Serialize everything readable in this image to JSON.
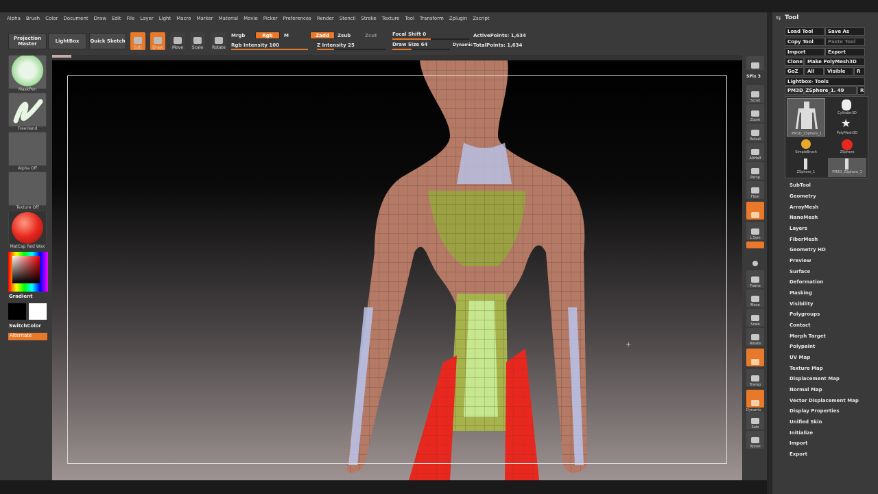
{
  "menu": [
    "Alpha",
    "Brush",
    "Color",
    "Document",
    "Draw",
    "Edit",
    "File",
    "Layer",
    "Light",
    "Macro",
    "Marker",
    "Material",
    "Movie",
    "Picker",
    "Preferences",
    "Render",
    "Stencil",
    "Stroke",
    "Texture",
    "Tool",
    "Transform",
    "Zplugin",
    "Zscript"
  ],
  "toolbar": {
    "projection_master": "Projection Master",
    "lightbox": "LightBox",
    "quick_sketch": "Quick Sketch",
    "edit": "Edit",
    "draw": "Draw",
    "move": "Move",
    "scale": "Scale",
    "rotate": "Rotate",
    "mrgb": "Mrgb",
    "rgb": "Rgb",
    "m": "M",
    "zadd": "Zadd",
    "zsub": "Zsub",
    "zcut": "Zcut",
    "rgb_intensity": "Rgb Intensity 100",
    "z_intensity": "Z Intensity 25",
    "focal_shift": "Focal Shift 0",
    "draw_size": "Draw Size 64",
    "dynamic": "Dynamic",
    "active_points": "ActivePoints: 1,634",
    "total_points": "TotalPoints: 1,634"
  },
  "sliders": {
    "rgb_intensity": 1.0,
    "z_intensity": 0.25,
    "focal_shift": 0.5,
    "draw_size": 0.33
  },
  "left_shelf": {
    "brush": "MaskPen",
    "stroke": "FreeHand",
    "alpha": "Alpha Off",
    "texture": "Texture Off",
    "material": "MatCap Red Wax",
    "gradient": "Gradient",
    "switch_color": "SwitchColor",
    "alternate": "Alternate"
  },
  "right_shelf": {
    "spix": "SPix 3",
    "scroll": "Scroll",
    "zoom": "Zoom",
    "actual": "Actual",
    "aahalf": "AAHalf",
    "persp": "Persp",
    "floor": "Floor",
    "lsym": "L.Sym",
    "frame": "Frame",
    "move": "Move",
    "scale": "Scale",
    "rotate": "Rotate",
    "transp": "Transp",
    "solo": "Solo",
    "xpose": "Xpose",
    "dynamic": "Dynamic"
  },
  "tool_panel": {
    "title": "Tool",
    "load_tool": "Load Tool",
    "save_as": "Save As",
    "copy_tool": "Copy Tool",
    "paste_tool": "Paste Tool",
    "import": "Import",
    "export": "Export",
    "clone": "Clone",
    "make_polymesh": "Make PolyMesh3D",
    "goz": "GoZ",
    "all": "All",
    "visible": "Visible",
    "r": "R",
    "lightbox_tools": "Lightbox› Tools",
    "current_tool": "PM3D_ZSphere_1. 49",
    "tools": [
      "PM3D_ZSphere_1",
      "Cylinder3D",
      "PolyMesh3D",
      "SimpleBrush",
      "ZSphere",
      "ZSphere_1",
      "PM3D_ZSphere_1"
    ],
    "sections": [
      "SubTool",
      "Geometry",
      "ArrayMesh",
      "NanoMesh",
      "Layers",
      "FiberMesh",
      "Geometry HD",
      "Preview",
      "Surface",
      "Deformation",
      "Masking",
      "Visibility",
      "Polygroups",
      "Contact",
      "Morph Target",
      "Polypaint",
      "UV Map",
      "Texture Map",
      "Displacement Map",
      "Normal Map",
      "Vector Displacement Map",
      "Display Properties",
      "Unified Skin",
      "Initialize",
      "Import",
      "Export"
    ]
  },
  "colors": {
    "accent": "#e8782a",
    "skin": "#b47a66",
    "mask_red": "#e8281f",
    "torso": "#9aa340",
    "highlight": "#b9c4ec"
  }
}
